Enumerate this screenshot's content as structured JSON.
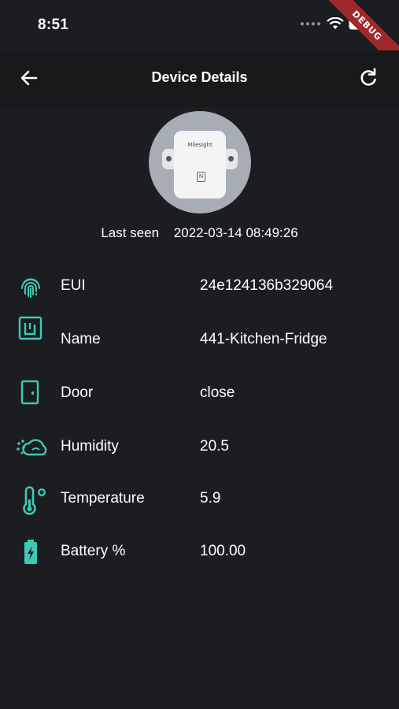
{
  "status_bar": {
    "time": "8:51",
    "debug_label": "DEBUG"
  },
  "app_bar": {
    "title": "Device Details",
    "back_icon": "arrow-left-icon",
    "refresh_icon": "refresh-icon"
  },
  "device": {
    "image_brand": "Milesight",
    "last_seen_label": "Last seen",
    "last_seen_value": "2022-03-14 08:49:26"
  },
  "details": [
    {
      "icon": "fingerprint-icon",
      "label": "EUI",
      "value": "24e124136b329064"
    },
    {
      "icon": "nfc-tag-icon",
      "label": "Name",
      "value": "441-Kitchen-Fridge"
    },
    {
      "icon": "door-icon",
      "label": "Door",
      "value": "close"
    },
    {
      "icon": "humidity-cloud-icon",
      "label": "Humidity",
      "value": "20.5"
    },
    {
      "icon": "thermometer-icon",
      "label": "Temperature",
      "value": "5.9"
    },
    {
      "icon": "battery-charging-icon",
      "label": "Battery %",
      "value": "100.00"
    }
  ],
  "colors": {
    "background": "#1b1d20",
    "app_bar": "#17191b",
    "accent": "#3ec9b5",
    "text": "#ffffff"
  }
}
